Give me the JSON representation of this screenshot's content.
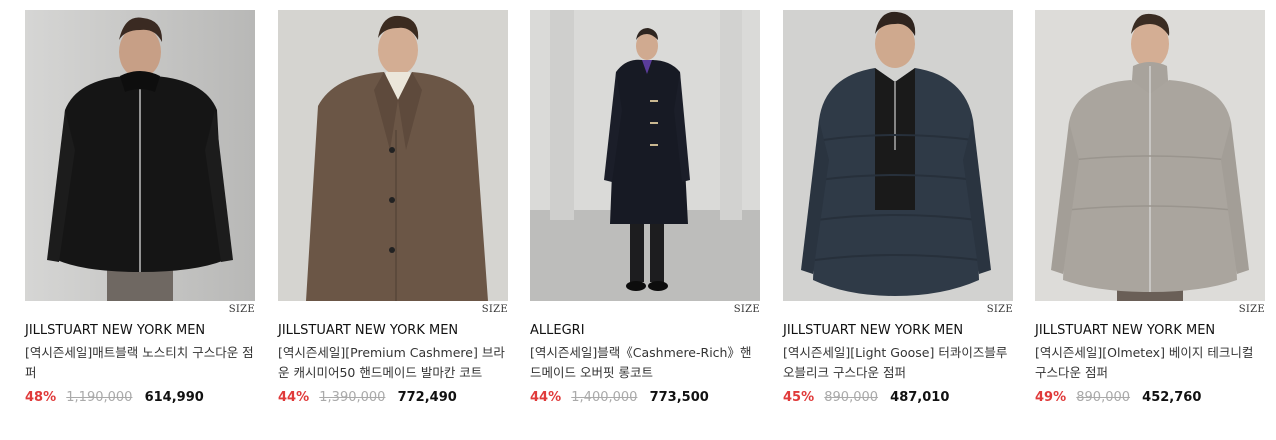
{
  "size_label": "SIZE",
  "products": [
    {
      "brand": "JILLSTUART NEW YORK MEN",
      "name": "[역시즌세일]매트블랙 노스티치 구스다운 점퍼",
      "discount": "48%",
      "original_price": "1,190,000",
      "sale_price": "614,990",
      "image_icon": "black-padded-jacket-photo",
      "colors": {
        "bg": "#c9c9c7",
        "garment": "#141414",
        "inner": "#ece9e2"
      }
    },
    {
      "brand": "JILLSTUART NEW YORK MEN",
      "name": "[역시즌세일][Premium Cashmere] 브라운 캐시미어50 핸드메이드 발마칸 코트",
      "discount": "44%",
      "original_price": "1,390,000",
      "sale_price": "772,490",
      "image_icon": "brown-cashmere-coat-photo",
      "colors": {
        "bg": "#d6d5d1",
        "garment": "#6b5545",
        "inner": "#e9e4d8"
      }
    },
    {
      "brand": "ALLEGRI",
      "name": "[역시즌세일]블랙《Cashmere-Rich》핸드메이드 오버핏 롱코트",
      "discount": "44%",
      "original_price": "1,400,000",
      "sale_price": "773,500",
      "image_icon": "black-long-duffle-coat-photo",
      "colors": {
        "bg": "#d9d9d7",
        "garment": "#171a24",
        "inner": "#5a3c9a"
      }
    },
    {
      "brand": "JILLSTUART NEW YORK MEN",
      "name": "[역시즌세일][Light Goose] 터콰이즈블루 오블리크 구스다운 점퍼",
      "discount": "45%",
      "original_price": "890,000",
      "sale_price": "487,010",
      "image_icon": "navy-puffer-jacket-photo",
      "colors": {
        "bg": "#d3d3d1",
        "garment": "#2f3a47",
        "inner": "#1a1a1a"
      }
    },
    {
      "brand": "JILLSTUART NEW YORK MEN",
      "name": "[역시즌세일][Olmetex] 베이지 테크니컬 구스다운 점퍼",
      "discount": "49%",
      "original_price": "890,000",
      "sale_price": "452,760",
      "image_icon": "beige-technical-puffer-photo",
      "colors": {
        "bg": "#dcdbd8",
        "garment": "#aaa59e",
        "inner": "#8a8680"
      }
    }
  ]
}
